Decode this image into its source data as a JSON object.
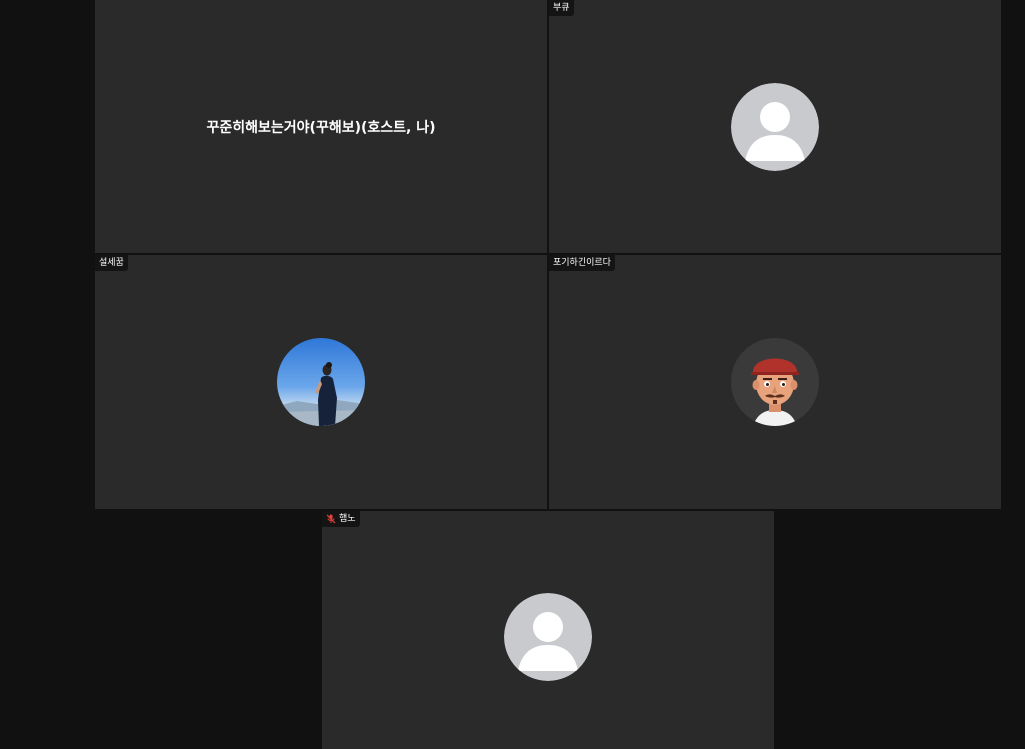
{
  "participants": [
    {
      "name": "꾸준히해보는거야(꾸해보)(호스트, 나)",
      "video": "off",
      "avatar": "none"
    },
    {
      "name": "부큐",
      "video": "off",
      "avatar": "default-person-icon"
    },
    {
      "name": "설세꿈",
      "video": "off",
      "avatar": "profile-photo"
    },
    {
      "name": "포기하긴이르다",
      "video": "off",
      "avatar": "cartoon-avatar"
    },
    {
      "name": "햄노",
      "video": "off",
      "avatar": "default-person-icon",
      "muted": true
    }
  ],
  "colors": {
    "background": "#111111",
    "tile": "#2a2a2a",
    "name_tag": "#141414",
    "muted_icon": "#e8413c"
  }
}
